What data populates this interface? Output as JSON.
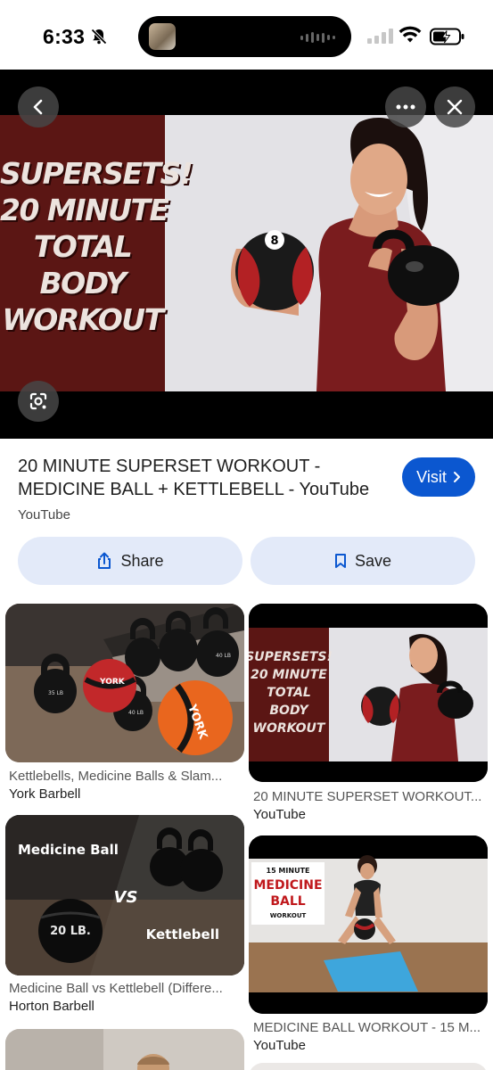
{
  "status_bar": {
    "time": "6:33"
  },
  "hero": {
    "title_lines": [
      "SUPERSETS!",
      "20 MINUTE",
      "TOTAL",
      "BODY",
      "WORKOUT"
    ],
    "ball_number": "8",
    "icons": [
      "back-icon",
      "more-icon",
      "close-icon",
      "lens-icon"
    ]
  },
  "result": {
    "title": "20 MINUTE SUPERSET WORKOUT - MEDICINE BALL + KETTLEBELL - YouTube",
    "source": "YouTube",
    "visit_label": "Visit",
    "share_label": "Share",
    "save_label": "Save"
  },
  "grid": [
    {
      "caption": "Kettlebells, Medicine Balls & Slam...",
      "source": "York Barbell",
      "image_text": [
        "YORK",
        "YORK",
        "40 LB",
        "35 LB",
        "40 LB"
      ]
    },
    {
      "caption": "20 MINUTE SUPERSET WORKOUT...",
      "source": "YouTube",
      "image_text": [
        "SUPERSETS!",
        "20 MINUTE",
        "TOTAL",
        "BODY",
        "WORKOUT"
      ]
    },
    {
      "caption": "Medicine Ball vs Kettlebell (Differe...",
      "source": "Horton Barbell",
      "image_text": [
        "Medicine Ball",
        "VS",
        "Kettlebell",
        "20 LB."
      ]
    },
    {
      "caption": "MEDICINE BALL WORKOUT - 15 M...",
      "source": "YouTube",
      "image_text": [
        "15 MINUTE",
        "MEDICINE",
        "BALL",
        "WORKOUT"
      ]
    }
  ],
  "colors": {
    "accent": "#0b57d0",
    "action_bg": "#e3eaf9",
    "hero_panel": "#5b1614"
  }
}
